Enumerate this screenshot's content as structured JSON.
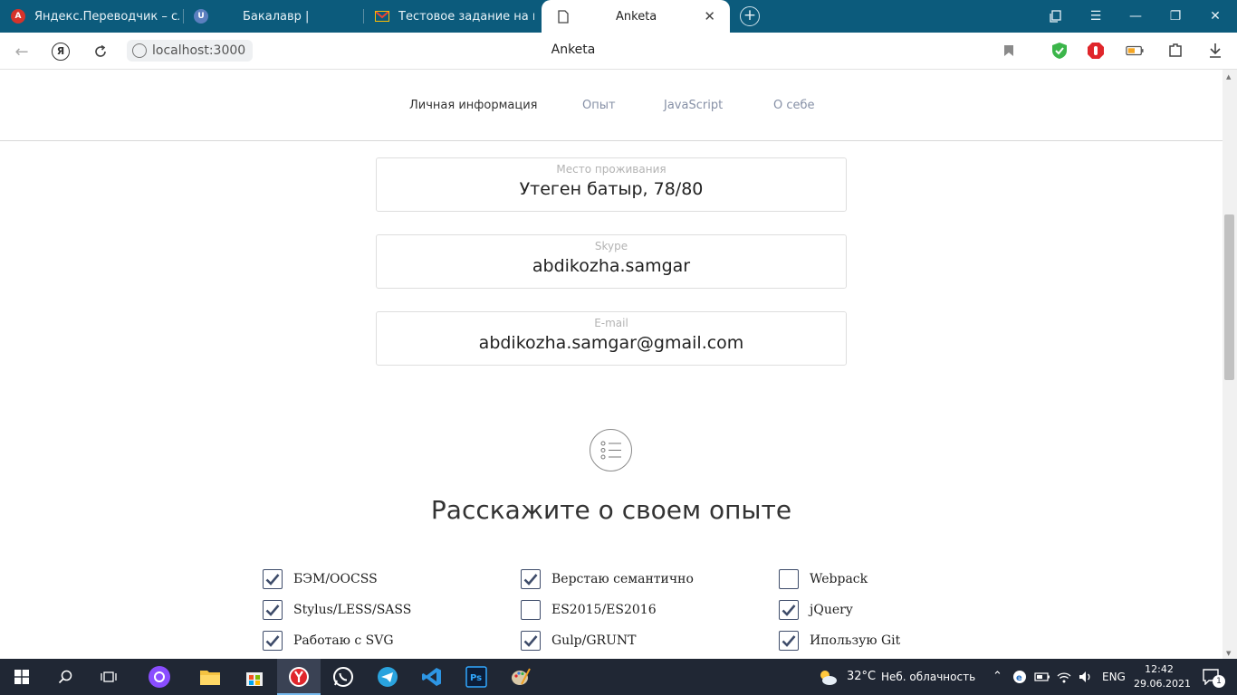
{
  "browser": {
    "tabs": [
      {
        "label": "Яндекс.Переводчик – сло",
        "favicon_color": "#d6332b"
      },
      {
        "label": "Бакалавр |",
        "favicon_color": "#5b7fbf"
      },
      {
        "label": "Тестовое задание на вак",
        "favicon_color": "#ea4335"
      },
      {
        "label": "Anketa",
        "favicon_color": "#444444"
      }
    ],
    "active_tab_index": 3,
    "url": "localhost:3000",
    "page_title": "Anketa",
    "yandex_badge": "Я"
  },
  "form_nav": {
    "items": [
      "Личная информация",
      "Опыт",
      "JavaScript",
      "О себе"
    ],
    "current_index": 0
  },
  "fields": [
    {
      "label": "Место проживания",
      "value": "Утеген батыр, 78/80"
    },
    {
      "label": "Skype",
      "value": "abdikozha.samgar"
    },
    {
      "label": "E-mail",
      "value": "abdikozha.samgar@gmail.com"
    }
  ],
  "experience": {
    "title": "Расскажите о своем опыте",
    "skills": [
      {
        "label": "БЭМ/OOCSS",
        "checked": true
      },
      {
        "label": "Верстаю семантично",
        "checked": true
      },
      {
        "label": "Webpack",
        "checked": false
      },
      {
        "label": "Stylus/LESS/SASS",
        "checked": true
      },
      {
        "label": "ES2015/ES2016",
        "checked": false
      },
      {
        "label": "jQuery",
        "checked": true
      },
      {
        "label": "Работаю с SVG",
        "checked": true
      },
      {
        "label": "Gulp/GRUNT",
        "checked": true
      },
      {
        "label": "Ипользую Git",
        "checked": true
      }
    ]
  },
  "taskbar": {
    "weather_temp": "32°C",
    "weather_text": "Неб. облачность",
    "language": "ENG",
    "time": "12:42",
    "date": "29.06.2021",
    "notification_count": "1"
  },
  "colors": {
    "tabbar": "#0c5b7c",
    "taskbar": "#202734",
    "checkbox": "#3e4c6a"
  }
}
